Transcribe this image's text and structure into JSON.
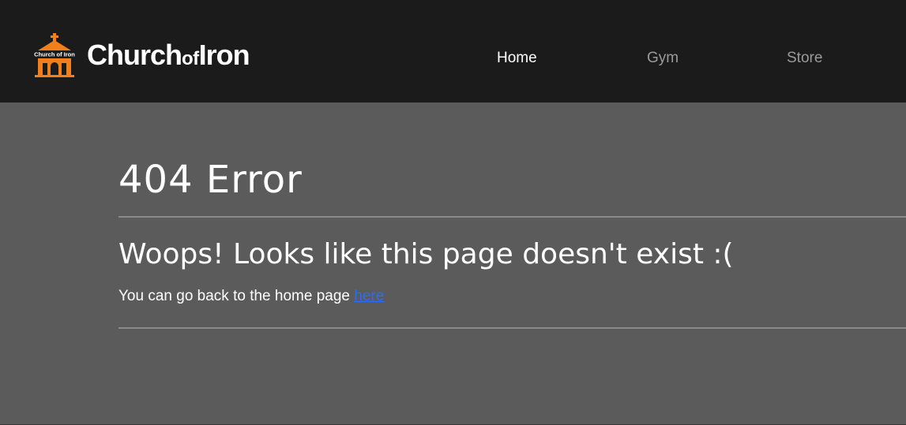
{
  "header": {
    "logo_text": "Church of Iron",
    "brand": {
      "part1": "Church",
      "part2": "of",
      "part3": "Iron"
    },
    "nav": {
      "home": "Home",
      "gym": "Gym",
      "store": "Store"
    }
  },
  "main": {
    "title": "404 Error",
    "subtitle": "Woops! Looks like this page doesn't exist :(",
    "back_text": "You can go back to the home page ",
    "back_link": "here"
  },
  "colors": {
    "header_bg": "#1b1b1b",
    "page_bg": "#5b5b5b",
    "logo_accent": "#f07f1c",
    "link": "#2a6cff"
  }
}
